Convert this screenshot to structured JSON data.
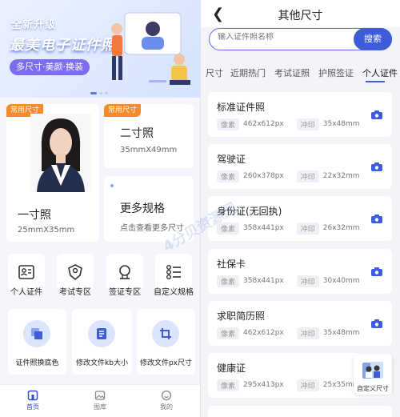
{
  "left": {
    "banner": {
      "subtitle": "全新升级",
      "title": "最美电子证件照",
      "pill": "多尺寸·美颜·换装"
    },
    "common_tag": "常用尺寸",
    "one_inch": {
      "title": "一寸照",
      "size": "25mmX35mm"
    },
    "two_inch": {
      "title": "二寸照",
      "size": "35mmX49mm"
    },
    "more": {
      "title": "更多规格",
      "desc": "点击查看更多尺寸"
    },
    "quick_tools": [
      {
        "label": "个人证件",
        "icon": "id-card-icon"
      },
      {
        "label": "考试专区",
        "icon": "exam-badge-icon"
      },
      {
        "label": "签证专区",
        "icon": "visa-icon"
      },
      {
        "label": "自定义规格",
        "icon": "custom-list-icon"
      }
    ],
    "features": [
      {
        "label": "证件照换底色",
        "icon": "background-color-icon"
      },
      {
        "label": "修改文件kb大小",
        "icon": "file-size-icon"
      },
      {
        "label": "修改文件px尺寸",
        "icon": "crop-icon"
      }
    ],
    "nav": [
      {
        "label": "首页",
        "icon": "home-icon",
        "active": true
      },
      {
        "label": "图库",
        "icon": "gallery-icon",
        "active": false
      },
      {
        "label": "我的",
        "icon": "profile-icon",
        "active": false
      }
    ]
  },
  "right": {
    "title": "其他尺寸",
    "search_placeholder": "输入证件照名称",
    "search_button": "搜索",
    "tabs": [
      "尺寸",
      "近期热门",
      "考试证照",
      "护照签证",
      "个人证件"
    ],
    "active_tab": "个人证件",
    "items": [
      {
        "name": "标准证件照",
        "px": "462x612px",
        "print": "35x48mm"
      },
      {
        "name": "驾驶证",
        "px": "260x378px",
        "print": "22x32mm"
      },
      {
        "name": "身份证(无回执)",
        "px": "358x441px",
        "print": "26x32mm"
      },
      {
        "name": "社保卡",
        "px": "358x441px",
        "print": "30x40mm"
      },
      {
        "name": "求职简历照",
        "px": "462x612px",
        "print": "35x48mm"
      },
      {
        "name": "健康证",
        "px": "295x413px",
        "print": "25x35mm"
      }
    ],
    "px_label": "像素",
    "print_label": "冲印",
    "custom_float": "自定义尺寸",
    "watermark": "4分贝资源网"
  },
  "colors": {
    "accent": "#3e5bdc",
    "tag": "#f48b2a",
    "bg": "#f3f4f8"
  }
}
